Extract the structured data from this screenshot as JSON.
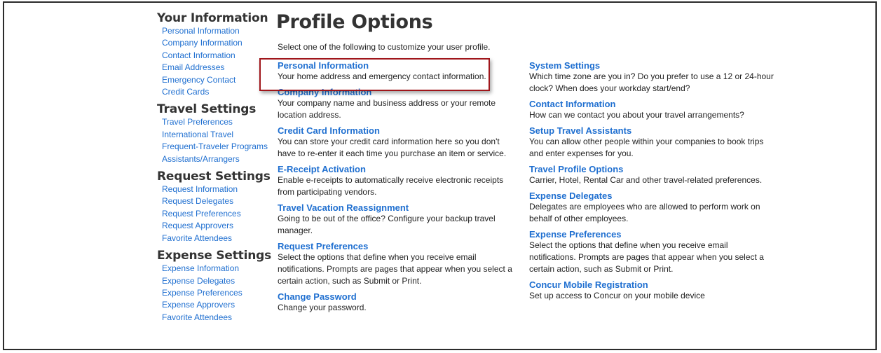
{
  "sidebar": {
    "groups": [
      {
        "title": "Your Information",
        "items": [
          "Personal Information",
          "Company Information",
          "Contact Information",
          "Email Addresses",
          "Emergency Contact",
          "Credit Cards"
        ]
      },
      {
        "title": "Travel Settings",
        "items": [
          "Travel Preferences",
          "International Travel",
          "Frequent-Traveler Programs",
          "Assistants/Arrangers"
        ]
      },
      {
        "title": "Request Settings",
        "items": [
          "Request Information",
          "Request Delegates",
          "Request Preferences",
          "Request Approvers",
          "Favorite Attendees"
        ]
      },
      {
        "title": "Expense Settings",
        "items": [
          "Expense Information",
          "Expense Delegates",
          "Expense Preferences",
          "Expense Approvers",
          "Favorite Attendees"
        ]
      }
    ]
  },
  "main": {
    "title": "Profile Options",
    "intro": "Select one of the following to customize your user profile.",
    "left_options": [
      {
        "title": "Personal Information",
        "desc": "Your home address and emergency contact information."
      },
      {
        "title": "Company Information",
        "desc": "Your company name and business address or your remote location address."
      },
      {
        "title": "Credit Card Information",
        "desc": "You can store your credit card information here so you don't have to re-enter it each time you purchase an item or service."
      },
      {
        "title": "E-Receipt Activation",
        "desc": "Enable e-receipts to automatically receive electronic receipts from participating vendors."
      },
      {
        "title": "Travel Vacation Reassignment",
        "desc": "Going to be out of the office? Configure your backup travel manager."
      },
      {
        "title": "Request Preferences",
        "desc": "Select the options that define when you receive email notifications. Prompts are pages that appear when you select a certain action, such as Submit or Print."
      },
      {
        "title": "Change Password",
        "desc": "Change your password."
      }
    ],
    "right_options": [
      {
        "title": "System Settings",
        "desc": "Which time zone are you in? Do you prefer to use a 12 or 24-hour clock? When does your workday start/end?"
      },
      {
        "title": "Contact Information",
        "desc": "How can we contact you about your travel arrangements?"
      },
      {
        "title": "Setup Travel Assistants",
        "desc": "You can allow other people within your companies to book trips and enter expenses for you."
      },
      {
        "title": "Travel Profile Options",
        "desc": "Carrier, Hotel, Rental Car and other travel-related preferences."
      },
      {
        "title": "Expense Delegates",
        "desc": "Delegates are employees who are allowed to perform work on behalf of other employees."
      },
      {
        "title": "Expense Preferences",
        "desc": "Select the options that define when you receive email notifications. Prompts are pages that appear when you select a certain action, such as Submit or Print."
      },
      {
        "title": "Concur Mobile Registration",
        "desc": "Set up access to Concur on your mobile device"
      }
    ]
  },
  "colors": {
    "link": "#1f6fd0",
    "heading": "#333333",
    "highlight_border": "#a0161b"
  }
}
